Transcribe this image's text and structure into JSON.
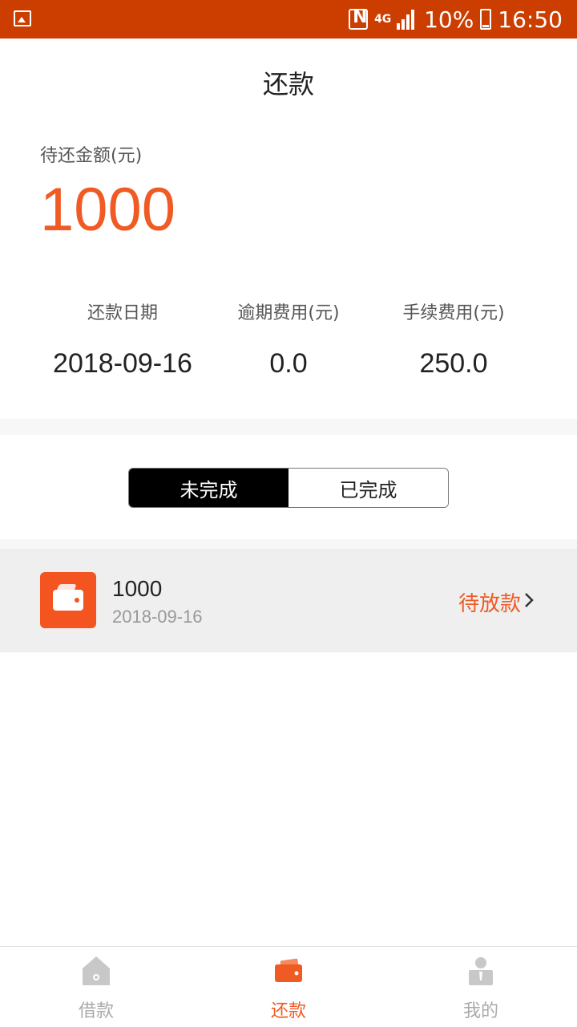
{
  "status_bar": {
    "network": "4G",
    "battery": "10%",
    "time": "16:50"
  },
  "header": {
    "title": "还款"
  },
  "summary": {
    "due_label": "待还金额(元)",
    "due_amount": "1000",
    "stats": [
      {
        "label": "还款日期",
        "value": "2018-09-16"
      },
      {
        "label": "逾期费用(元)",
        "value": "0.0"
      },
      {
        "label": "手续费用(元)",
        "value": "250.0"
      }
    ]
  },
  "segment": {
    "tabs": [
      {
        "label": "未完成",
        "selected": true
      },
      {
        "label": "已完成",
        "selected": false
      }
    ]
  },
  "records": [
    {
      "amount": "1000",
      "date": "2018-09-16",
      "status": "待放款"
    }
  ],
  "tabbar": {
    "items": [
      {
        "label": "借款",
        "icon": "home-icon",
        "active": false
      },
      {
        "label": "还款",
        "icon": "wallet-icon",
        "active": true
      },
      {
        "label": "我的",
        "icon": "person-icon",
        "active": false
      }
    ]
  },
  "colors": {
    "status_bar": "#cc3d00",
    "accent": "#f05a23",
    "inactive_tab": "#aaaaaa"
  }
}
